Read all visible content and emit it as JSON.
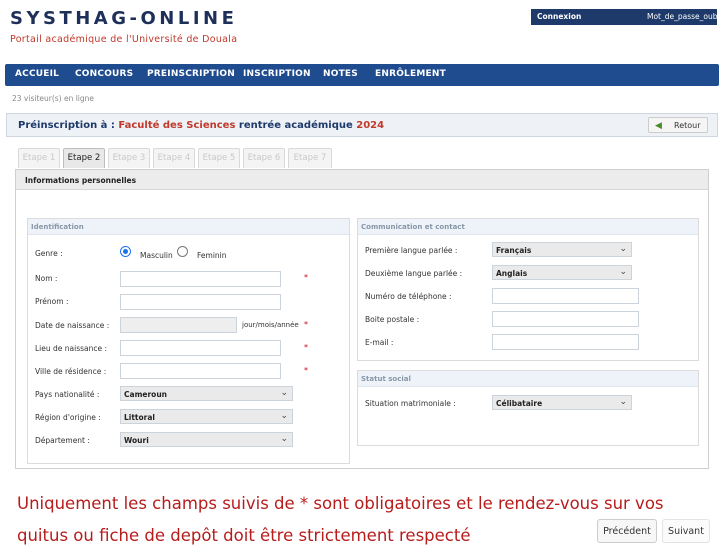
{
  "header": {
    "brand": "SYSTHAG-ONLINE",
    "subtitle": "Portail académique de l'Université de Douala",
    "login": "Connexion",
    "forgot": "Mot_de_passe_oublié"
  },
  "nav": [
    "ACCUEIL",
    "CONCOURS",
    "PREINSCRIPTION",
    "INSCRIPTION",
    "NOTES",
    "ENRÔLEMENT"
  ],
  "visitors": "23 visiteur(s) en ligne",
  "title": {
    "prefix": "Préinscription à :",
    "faculty": "Faculté des Sciences",
    "mid": "rentrée académique",
    "year": "2024",
    "back": "Retour"
  },
  "tabs": [
    "Etape 1",
    "Etape 2",
    "Etape 3",
    "Etape 4",
    "Etape 5",
    "Etape 6",
    "Etape 7"
  ],
  "panel_title": "Informations personnelles",
  "identification": {
    "title": "Identification",
    "genre_label": "Genre :",
    "masculin": "Masculin",
    "feminin": "Feminin",
    "nom": "Nom :",
    "prenom": "Prénom :",
    "dob": "Date de naissance :",
    "dob_hint": "jour/mois/année",
    "lieu": "Lieu de naissance :",
    "ville": "Ville de résidence :",
    "pays": "Pays nationalité :",
    "pays_val": "Cameroun",
    "region": "Région d'origine :",
    "region_val": "Littoral",
    "dept": "Département :",
    "dept_val": "Wouri",
    "star": "*"
  },
  "communication": {
    "title": "Communication et contact",
    "lang1": "Première langue parlée :",
    "lang1_val": "Français",
    "lang2": "Deuxième langue parlée :",
    "lang2_val": "Anglais",
    "tel": "Numéro de téléphone :",
    "bp": "Boite postale :",
    "email": "E-mail :"
  },
  "social": {
    "title": "Statut social",
    "situation": "Situation matrimoniale :",
    "situation_val": "Célibataire"
  },
  "note": {
    "line1": "Uniquement les champs suivis de * sont obligatoires et le rendez-vous sur vos",
    "line2": "quitus ou fiche de depôt doit être strictement respecté"
  },
  "buttons": {
    "prev": "Précédent",
    "next": "Suivant"
  }
}
